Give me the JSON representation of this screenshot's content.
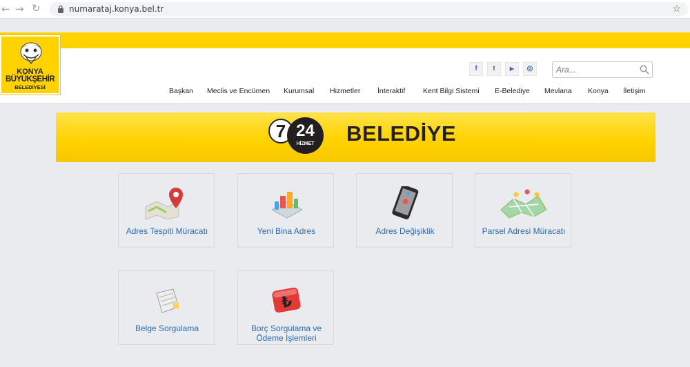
{
  "browser": {
    "back_icon": "arrow-left-icon",
    "forward_icon": "arrow-right-icon",
    "reload_icon": "reload-icon",
    "url": "numarataj.konya.bel.tr",
    "star_icon": "star-icon"
  },
  "logo": {
    "line1": "KONYA",
    "line2": "BÜYÜKŞEHİR",
    "line3": "BELEDİYESİ"
  },
  "social": [
    {
      "icon": "facebook-icon",
      "glyph": "f"
    },
    {
      "icon": "twitter-icon",
      "glyph": "t"
    },
    {
      "icon": "youtube-icon",
      "glyph": "▶"
    },
    {
      "icon": "instagram-icon",
      "glyph": "◎"
    }
  ],
  "search": {
    "placeholder": "Ara..."
  },
  "menu": [
    "Başkan",
    "Meclis ve Encümen",
    "Kurumsal",
    "Hizmetler",
    "İnteraktif",
    "Kent Bilgi Sistemi",
    "E-Belediye",
    "Mevlana",
    "Konya",
    "İletişim"
  ],
  "banner": {
    "seven": "7",
    "twentyfour": "24",
    "hizmet": "HİZMET",
    "title": "BELEDİYE"
  },
  "tiles": [
    {
      "label": "Adres Tespiti Müracatı",
      "icon": "map-pin-icon"
    },
    {
      "label": "Yeni Bina Adres",
      "icon": "building-map-icon"
    },
    {
      "label": "Adres Değişiklik",
      "icon": "phone-location-icon"
    },
    {
      "label": "Parsel Adresi Müracatı",
      "icon": "parcel-map-icon"
    },
    {
      "label": "Belge Sorgulama",
      "icon": "document-icon"
    },
    {
      "label_line1": "Borç Sorgulama ve",
      "label_line2": "Ödeme İşlemleri",
      "icon": "lira-payment-icon"
    }
  ],
  "colors": {
    "brand_yellow": "#ffd200",
    "link_blue": "#2a6db5",
    "dark": "#231f20"
  }
}
